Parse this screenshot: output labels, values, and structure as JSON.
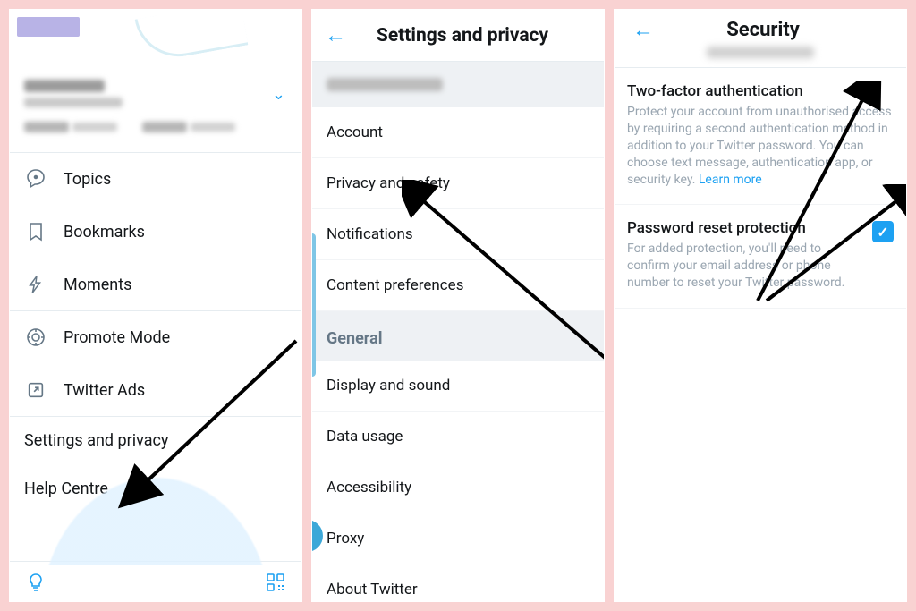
{
  "panel1": {
    "nav": {
      "topics": "Topics",
      "bookmarks": "Bookmarks",
      "moments": "Moments",
      "promote_mode": "Promote Mode",
      "twitter_ads": "Twitter Ads",
      "settings": "Settings and privacy",
      "help": "Help Centre"
    }
  },
  "panel2": {
    "title": "Settings and privacy",
    "items": {
      "account": "Account",
      "privacy": "Privacy and safety",
      "notifications": "Notifications",
      "content_prefs": "Content preferences",
      "general_header": "General",
      "display_sound": "Display and sound",
      "data_usage": "Data usage",
      "accessibility": "Accessibility",
      "proxy": "Proxy",
      "about": "About Twitter"
    }
  },
  "panel3": {
    "title": "Security",
    "twofa": {
      "title": "Two-factor authentication",
      "desc": "Protect your account from unauthorised access by requiring a second authentication method in addition to your Twitter password. You can choose text message, authentication app, or security key. ",
      "learn": "Learn more"
    },
    "pwreset": {
      "title": "Password reset protection",
      "desc": "For added protection, you'll need to confirm your email address or phone number to reset your Twitter password.",
      "checked": true
    }
  }
}
